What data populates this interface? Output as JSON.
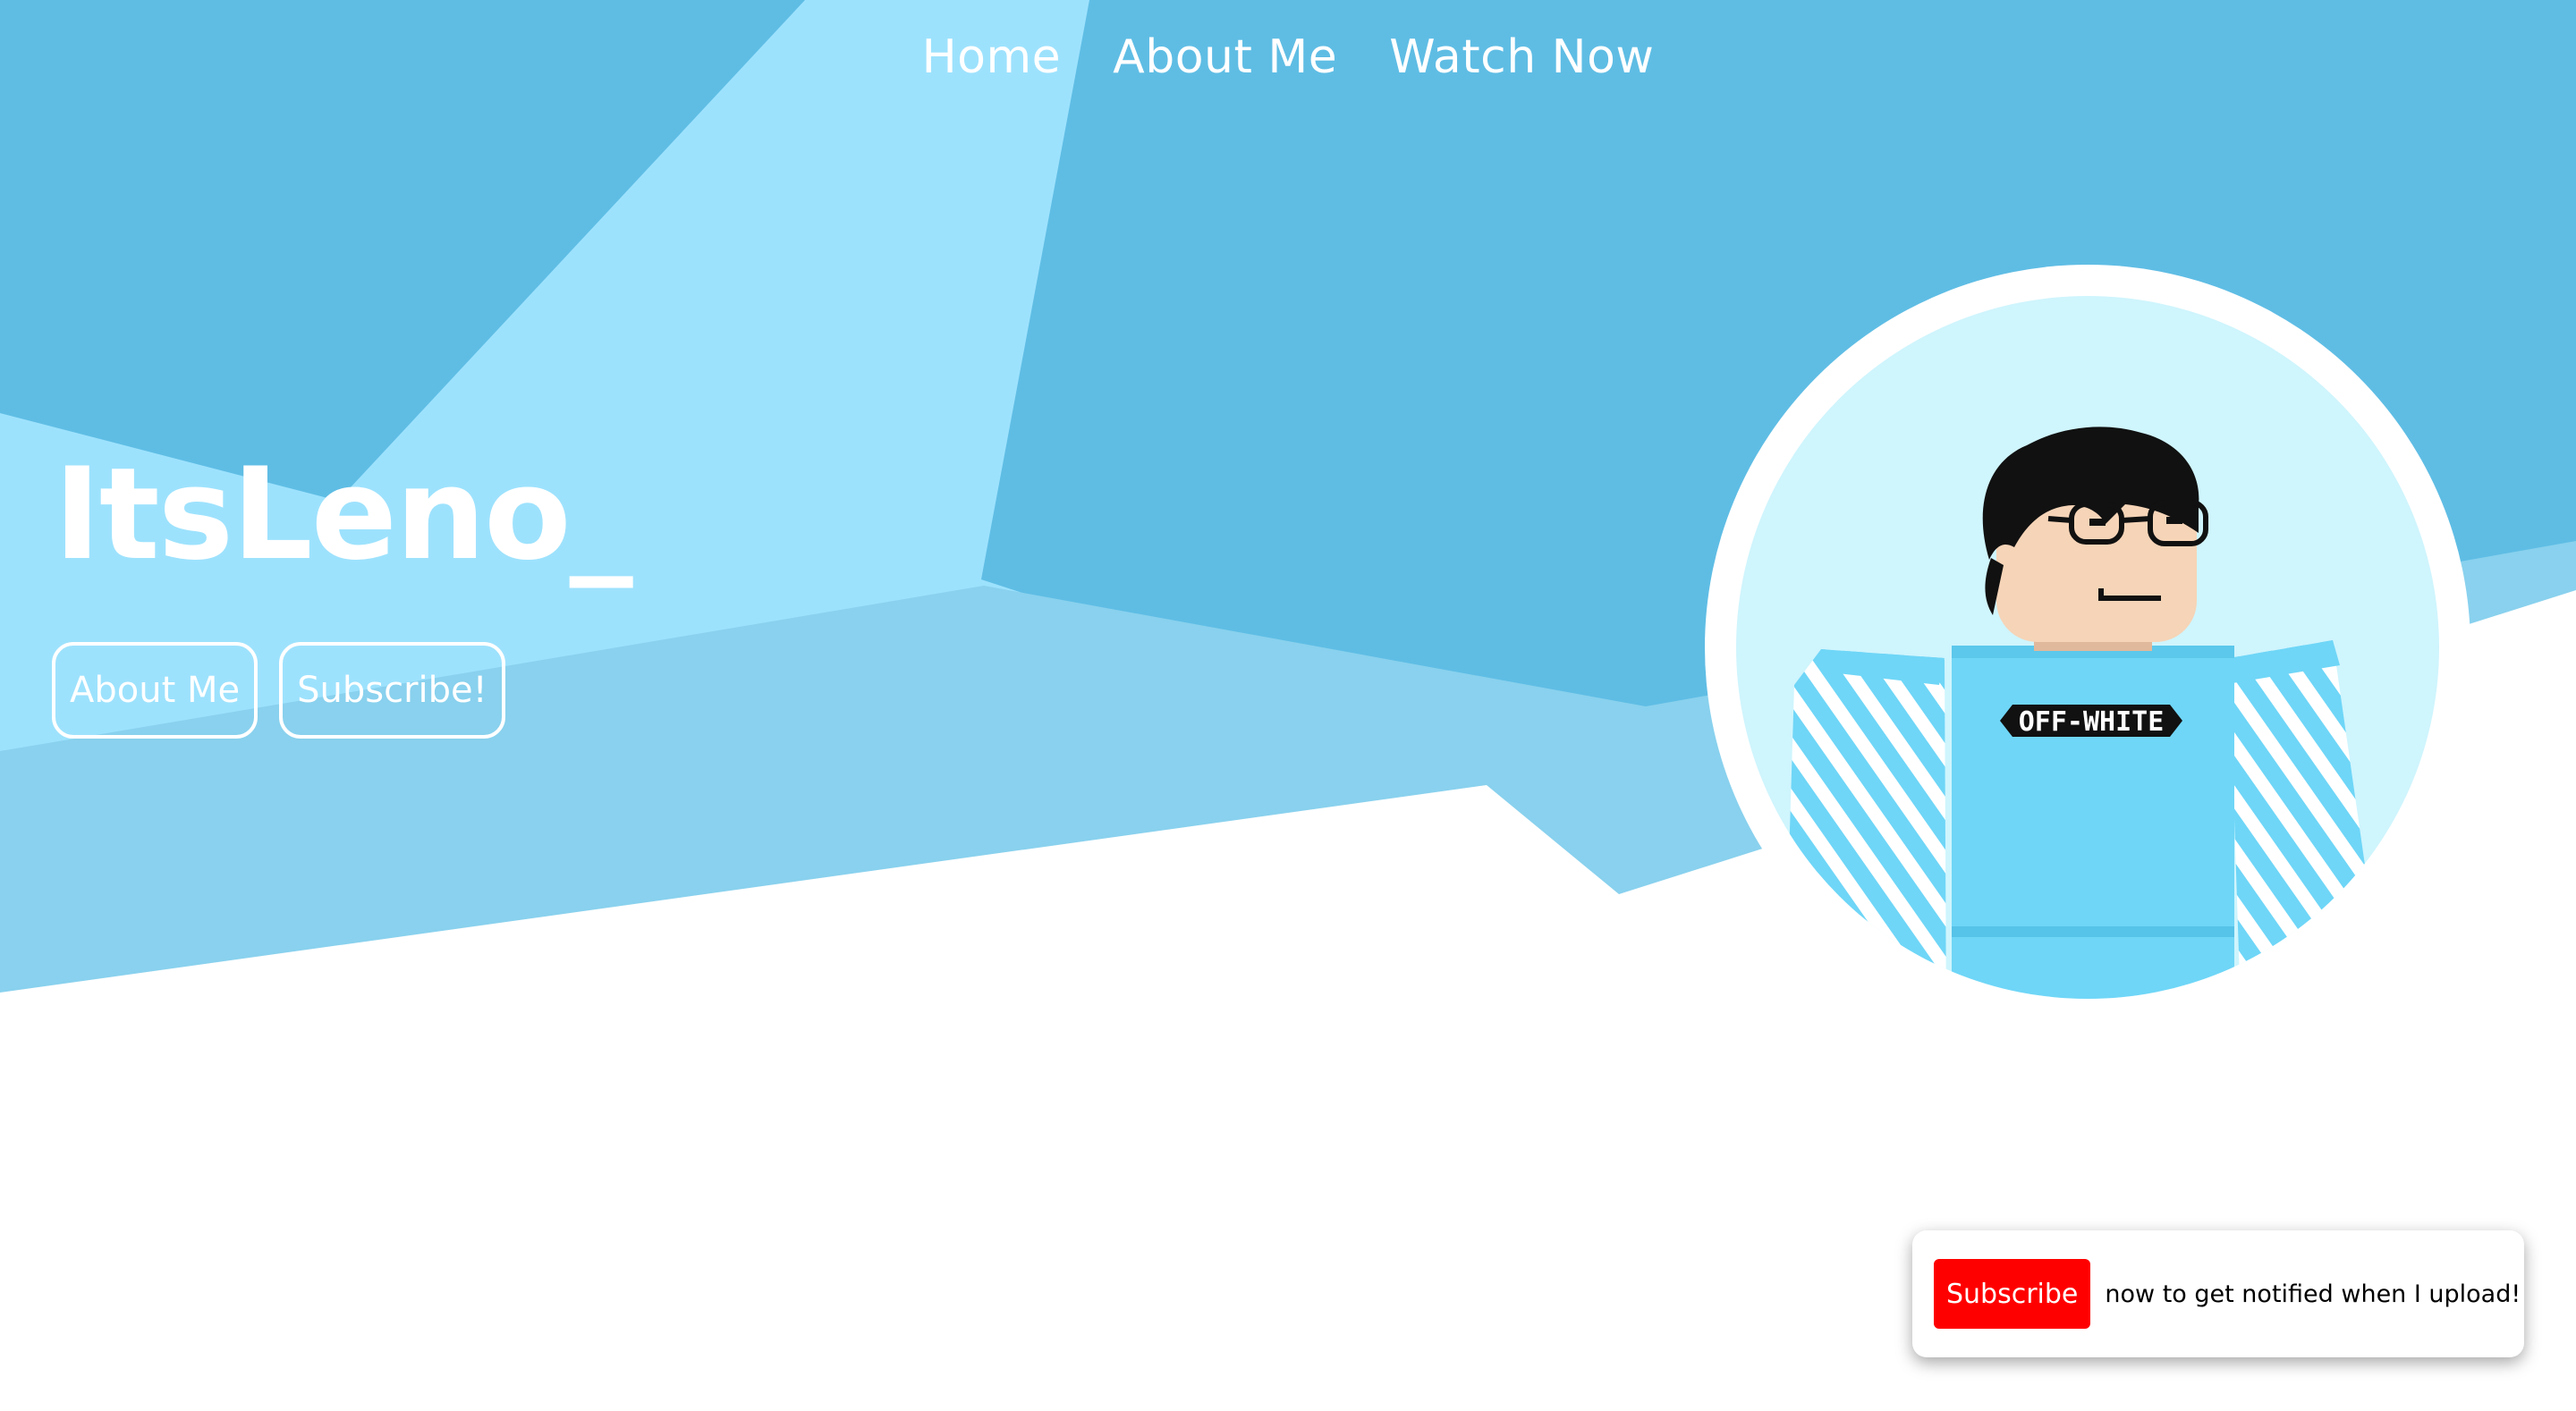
{
  "nav": {
    "items": [
      {
        "label": "Home"
      },
      {
        "label": "About Me"
      },
      {
        "label": "Watch Now"
      }
    ]
  },
  "hero": {
    "title": "ItsLeno_",
    "buttons": {
      "about": "About Me",
      "subscribe": "Subscribe!"
    }
  },
  "avatar": {
    "shirt_text": "OFF-WHITE"
  },
  "toast": {
    "button": "Subscribe",
    "message": "now to get notified when I upload!"
  },
  "colors": {
    "sky_dark": "#5fbde4",
    "sky_light": "#9de2fd",
    "sky_mid": "#89d1ee",
    "white": "#ffffff",
    "youtube_red": "#ff0000"
  }
}
